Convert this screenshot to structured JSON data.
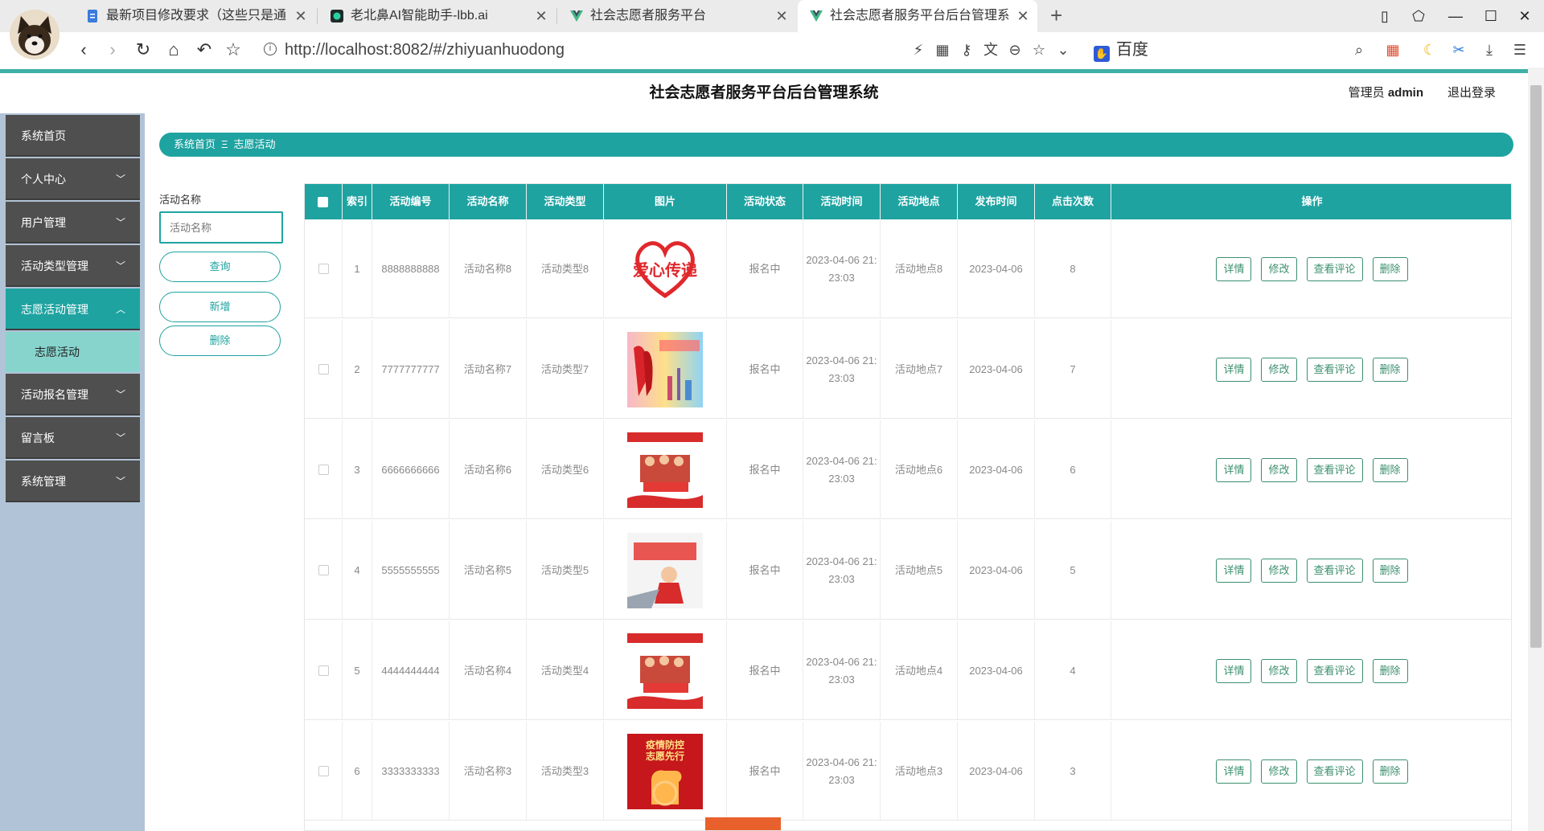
{
  "browser": {
    "tabs": [
      {
        "title": "最新项目修改要求（这些只是通用",
        "icon": "doc-icon"
      },
      {
        "title": "老北鼻AI智能助手-lbb.ai",
        "icon": "ai-icon"
      },
      {
        "title": "社会志愿者服务平台",
        "icon": "vue-icon"
      },
      {
        "title": "社会志愿者服务平台后台管理系",
        "icon": "vue-icon"
      }
    ],
    "url": "http://localhost:8082/#/zhiyuanhuodong",
    "search_engine": "百度"
  },
  "header": {
    "title": "社会志愿者服务平台后台管理系统",
    "user_prefix": "管理员",
    "user_name": "admin",
    "logout": "退出登录"
  },
  "sidebar": {
    "items": [
      {
        "label": "系统首页"
      },
      {
        "label": "个人中心"
      },
      {
        "label": "用户管理"
      },
      {
        "label": "活动类型管理"
      },
      {
        "label": "志愿活动管理"
      },
      {
        "label": "活动报名管理"
      },
      {
        "label": "留言板"
      },
      {
        "label": "系统管理"
      }
    ],
    "sub_item": "志愿活动"
  },
  "breadcrumb": {
    "home": "系统首页",
    "sep": "Ξ",
    "current": "志愿活动"
  },
  "search": {
    "label": "活动名称",
    "placeholder": "活动名称",
    "query_btn": "查询",
    "add_btn": "新增",
    "delete_btn": "删除"
  },
  "table": {
    "headers": [
      "索引",
      "活动编号",
      "活动名称",
      "活动类型",
      "图片",
      "活动状态",
      "活动时间",
      "活动地点",
      "发布时间",
      "点击次数",
      "操作"
    ],
    "actions": [
      "详情",
      "修改",
      "查看评论",
      "删除"
    ],
    "rows": [
      {
        "index": "1",
        "code": "8888888888",
        "name": "活动名称8",
        "type": "活动类型8",
        "status": "报名中",
        "time_a": "2023-04-06 21:",
        "time_b": "23:03",
        "place": "活动地点8",
        "pub": "2023-04-06",
        "clicks": "8",
        "image_text": "爱心传递"
      },
      {
        "index": "2",
        "code": "7777777777",
        "name": "活动名称7",
        "type": "活动类型7",
        "status": "报名中",
        "time_a": "2023-04-06 21:",
        "time_b": "23:03",
        "place": "活动地点7",
        "pub": "2023-04-06",
        "clicks": "7",
        "image_text": ""
      },
      {
        "index": "3",
        "code": "6666666666",
        "name": "活动名称6",
        "type": "活动类型6",
        "status": "报名中",
        "time_a": "2023-04-06 21:",
        "time_b": "23:03",
        "place": "活动地点6",
        "pub": "2023-04-06",
        "clicks": "6",
        "image_text": ""
      },
      {
        "index": "4",
        "code": "5555555555",
        "name": "活动名称5",
        "type": "活动类型5",
        "status": "报名中",
        "time_a": "2023-04-06 21:",
        "time_b": "23:03",
        "place": "活动地点5",
        "pub": "2023-04-06",
        "clicks": "5",
        "image_text": ""
      },
      {
        "index": "5",
        "code": "4444444444",
        "name": "活动名称4",
        "type": "活动类型4",
        "status": "报名中",
        "time_a": "2023-04-06 21:",
        "time_b": "23:03",
        "place": "活动地点4",
        "pub": "2023-04-06",
        "clicks": "4",
        "image_text": ""
      },
      {
        "index": "6",
        "code": "3333333333",
        "name": "活动名称3",
        "type": "活动类型3",
        "status": "报名中",
        "time_a": "2023-04-06 21:",
        "time_b": "23:03",
        "place": "活动地点3",
        "pub": "2023-04-06",
        "clicks": "3",
        "image_text": "疫情防控 志愿先行"
      }
    ]
  },
  "colors": {
    "accent": "#1ea3a1",
    "sidebar": "#4f4f4f",
    "sidebar_bg": "#b1c3d6",
    "submenu": "#87d4cd"
  }
}
